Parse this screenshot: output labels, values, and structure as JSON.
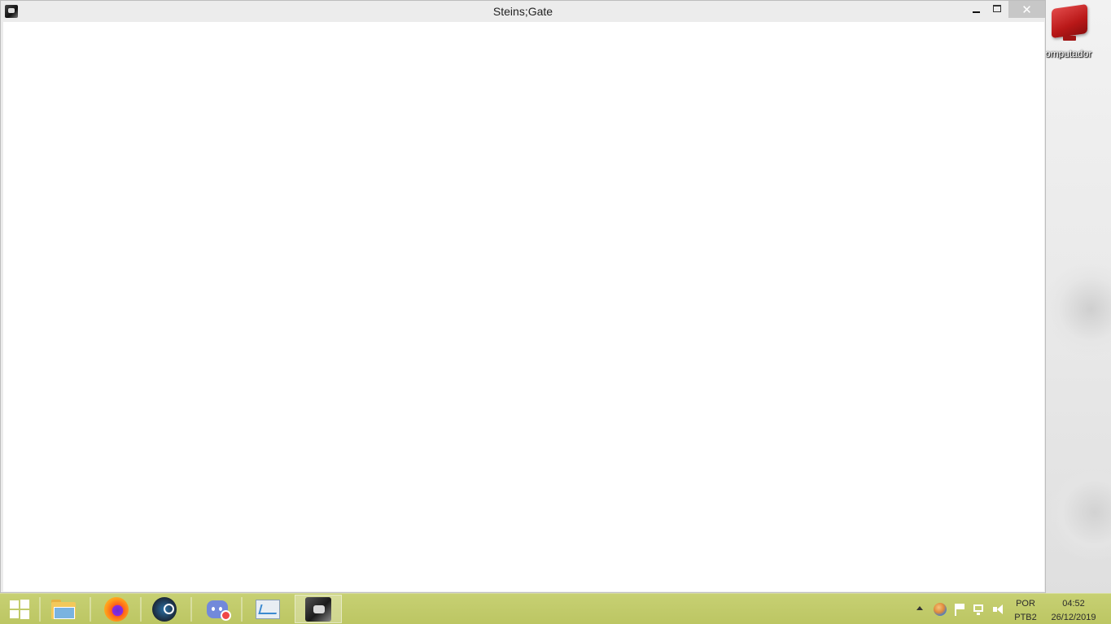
{
  "window": {
    "title": "Steins;Gate",
    "minimize_label": "",
    "close_label": "✕"
  },
  "desktop": {
    "icon_label": "omputador"
  },
  "taskbar": {
    "pinned": [
      "file-explorer",
      "firefox",
      "steam",
      "discord",
      "resource-monitor",
      "steins-gate"
    ],
    "tray": {
      "language_top": "POR",
      "language_bottom": "PTB2",
      "time": "04:52",
      "date": "26/12/2019"
    }
  },
  "colors": {
    "taskbar": "#bcc663",
    "close_button": "#c7c7c7",
    "window_client": "#ffffff"
  }
}
